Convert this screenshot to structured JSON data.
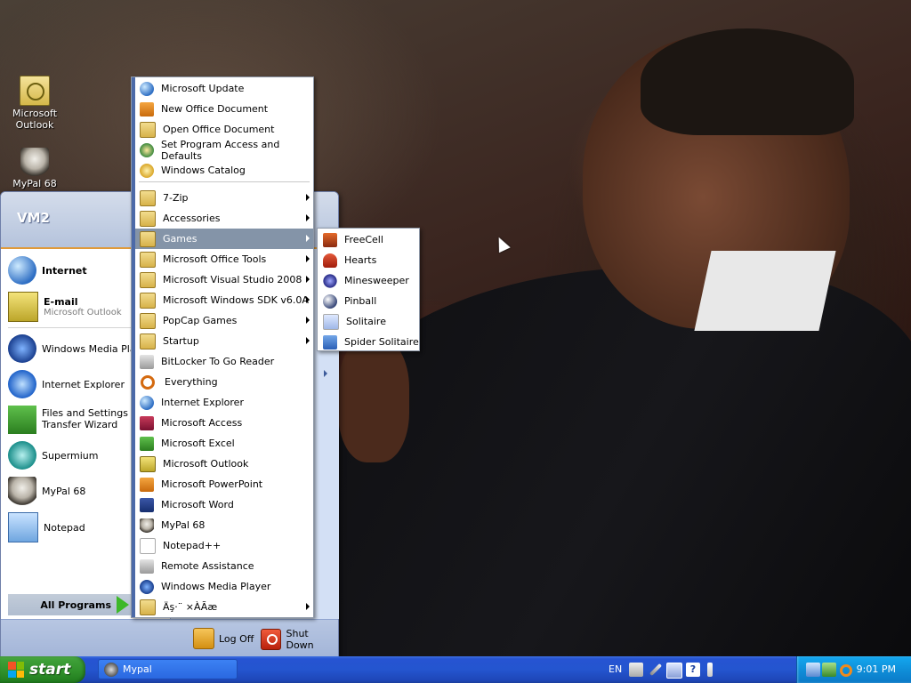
{
  "desktop": {
    "icons": [
      {
        "label": "Microsoft\nOutlook",
        "icon": "outlook-icon"
      },
      {
        "label": "MyPal 68",
        "icon": "raccoon-icon"
      }
    ]
  },
  "start_menu": {
    "user": "VM2",
    "pinned": [
      {
        "label": "Internet",
        "icon": "globe-icon"
      },
      {
        "label": "E-mail",
        "sublabel": "Microsoft Outlook",
        "icon": "outlook-icon"
      }
    ],
    "recent": [
      {
        "label": "Windows Media Player",
        "icon": "media-player-icon"
      },
      {
        "label": "Internet Explorer",
        "icon": "ie-icon"
      },
      {
        "label": "Files and Settings Transfer Wizard",
        "icon": "transfer-wizard-icon"
      },
      {
        "label": "Supermium",
        "icon": "supermium-icon"
      },
      {
        "label": "MyPal 68",
        "icon": "raccoon-icon"
      },
      {
        "label": "Notepad",
        "icon": "notepad-icon"
      }
    ],
    "all_programs": "All Programs",
    "log_off": "Log Off",
    "shut_down": "Shut Down"
  },
  "programs_menu": {
    "items": [
      {
        "label": "Microsoft Update",
        "icon": "update-icon",
        "submenu": false
      },
      {
        "label": "New Office Document",
        "icon": "office-doc-icon",
        "submenu": false
      },
      {
        "label": "Open Office Document",
        "icon": "open-folder-icon",
        "submenu": false
      },
      {
        "label": "Set Program Access and Defaults",
        "icon": "defaults-icon",
        "submenu": false
      },
      {
        "label": "Windows Catalog",
        "icon": "catalog-icon",
        "submenu": false
      },
      {
        "label": "7-Zip",
        "icon": "folder-icon",
        "submenu": true
      },
      {
        "label": "Accessories",
        "icon": "folder-icon",
        "submenu": true
      },
      {
        "label": "Games",
        "icon": "folder-icon",
        "submenu": true,
        "highlighted": true
      },
      {
        "label": "Microsoft Office Tools",
        "icon": "folder-icon",
        "submenu": true
      },
      {
        "label": "Microsoft Visual Studio 2008",
        "icon": "folder-icon",
        "submenu": true
      },
      {
        "label": "Microsoft Windows SDK v6.0A",
        "icon": "folder-icon",
        "submenu": true
      },
      {
        "label": "PopCap Games",
        "icon": "folder-icon",
        "submenu": true
      },
      {
        "label": "Startup",
        "icon": "folder-icon",
        "submenu": true
      },
      {
        "label": "BitLocker To Go Reader",
        "icon": "bitlocker-icon",
        "submenu": false
      },
      {
        "label": "Everything",
        "icon": "search-icon",
        "submenu": false
      },
      {
        "label": "Internet Explorer",
        "icon": "ie-icon",
        "submenu": false
      },
      {
        "label": "Microsoft Access",
        "icon": "access-icon",
        "submenu": false
      },
      {
        "label": "Microsoft Excel",
        "icon": "excel-icon",
        "submenu": false
      },
      {
        "label": "Microsoft Outlook",
        "icon": "outlook-icon",
        "submenu": false
      },
      {
        "label": "Microsoft PowerPoint",
        "icon": "powerpoint-icon",
        "submenu": false
      },
      {
        "label": "Microsoft Word",
        "icon": "word-icon",
        "submenu": false
      },
      {
        "label": "MyPal 68",
        "icon": "raccoon-icon",
        "submenu": false
      },
      {
        "label": "Notepad++",
        "icon": "notepadpp-icon",
        "submenu": false
      },
      {
        "label": "Remote Assistance",
        "icon": "remote-assistance-icon",
        "submenu": false
      },
      {
        "label": "Windows Media Player",
        "icon": "media-player-icon",
        "submenu": false
      },
      {
        "label": "Äş·¨ ×ÀÃæ",
        "icon": "folder-icon",
        "submenu": true
      }
    ]
  },
  "games_menu": {
    "items": [
      {
        "label": "FreeCell",
        "icon": "freecell-icon"
      },
      {
        "label": "Hearts",
        "icon": "hearts-icon"
      },
      {
        "label": "Minesweeper",
        "icon": "minesweeper-icon"
      },
      {
        "label": "Pinball",
        "icon": "pinball-icon"
      },
      {
        "label": "Solitaire",
        "icon": "solitaire-icon"
      },
      {
        "label": "Spider Solitaire",
        "icon": "spider-solitaire-icon"
      }
    ]
  },
  "taskbar": {
    "start": "start",
    "task": "Mypal",
    "language": "EN",
    "clock": "9:01 PM"
  },
  "colors": {
    "taskbar": "#2455cf",
    "start_button": "#3d9f37",
    "menu_highlight": "#8494a8",
    "tray": "#0f8fd9"
  }
}
